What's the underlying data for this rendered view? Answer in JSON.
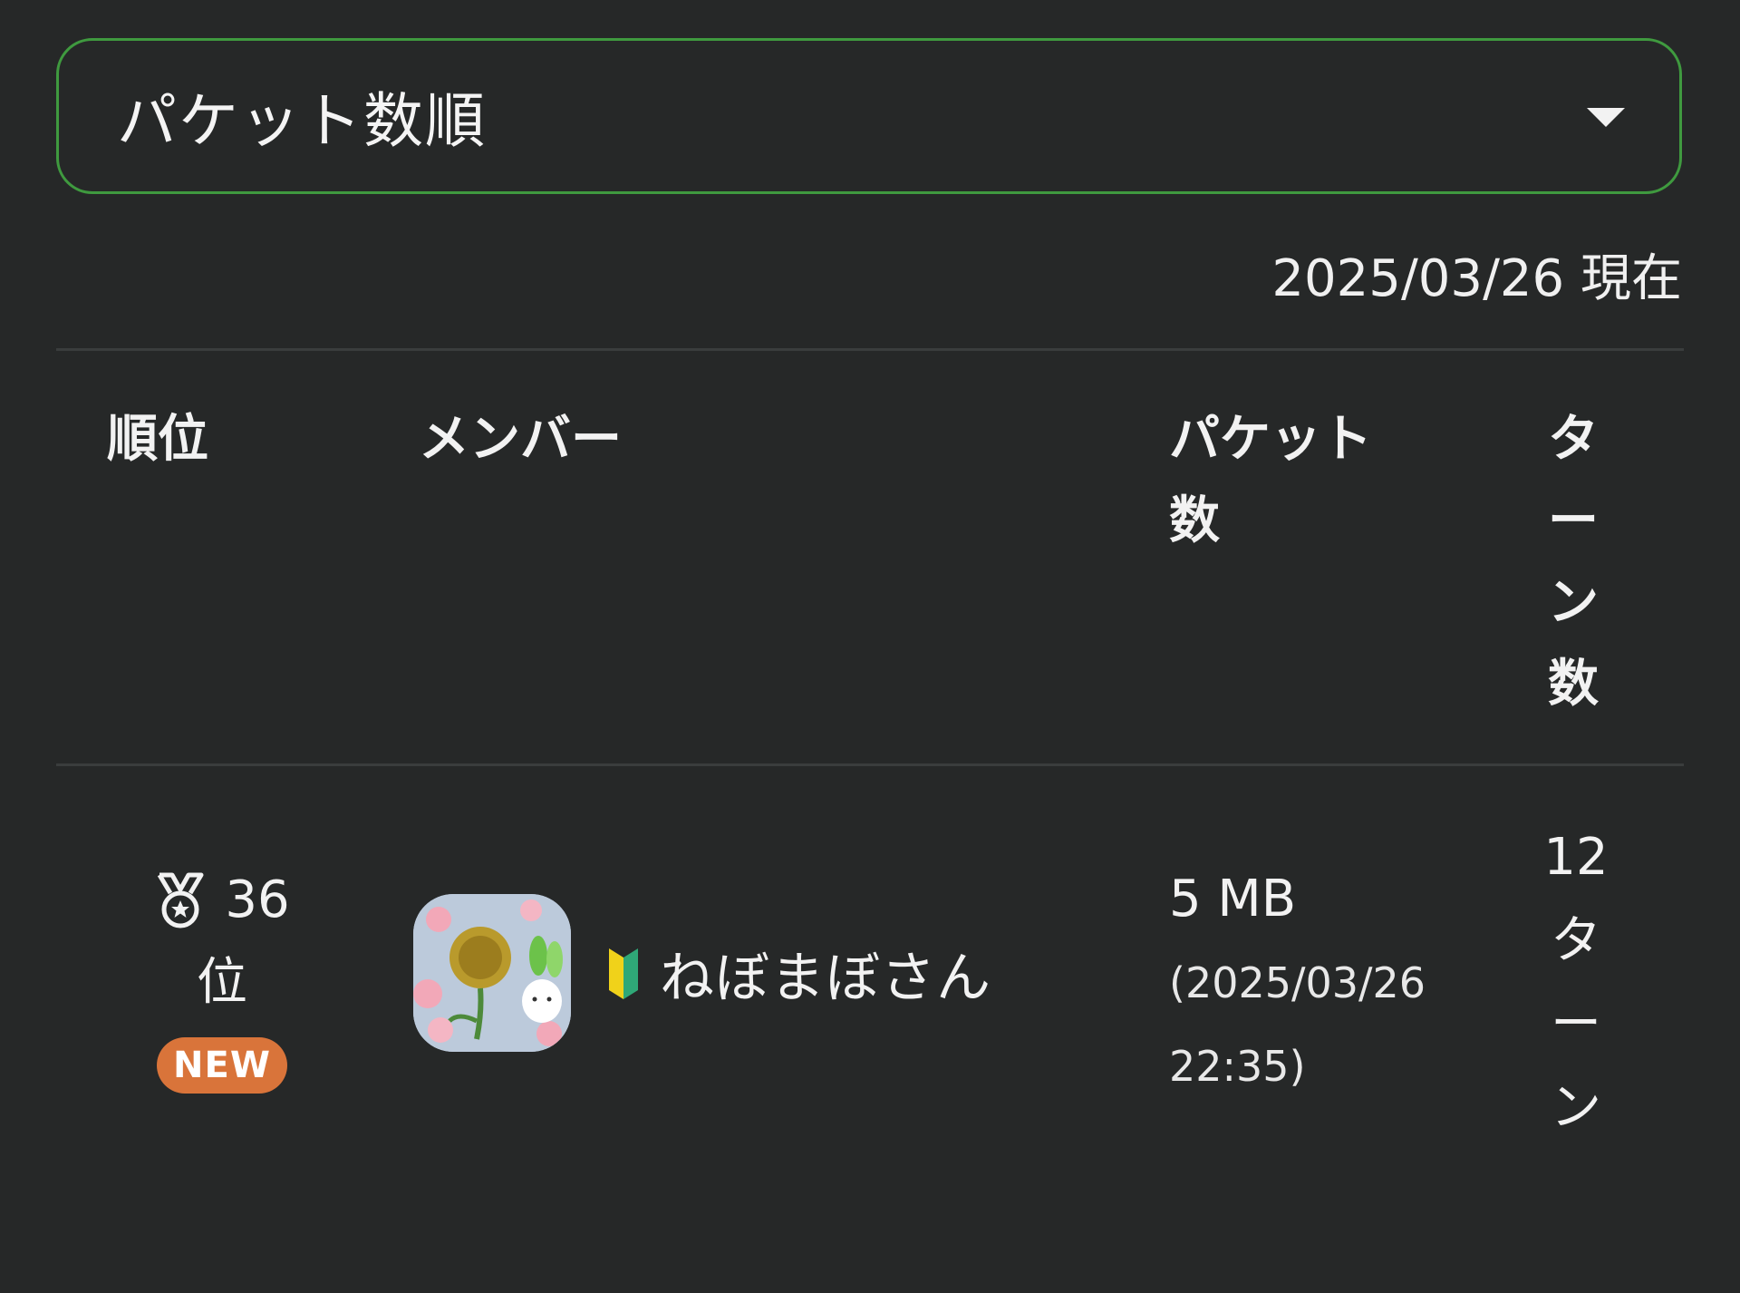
{
  "sort": {
    "selected": "パケット数順"
  },
  "as_of": "2025/03/26 現在",
  "table": {
    "headers": {
      "rank": "順位",
      "member": "メンバー",
      "packets": "パケット数",
      "turns": "ターン数"
    },
    "row": {
      "rank_number": "36",
      "rank_suffix": "位",
      "badge": "NEW",
      "member_name": "ねぼまぼさん",
      "packets": "5 MB",
      "packets_time": "(2025/03/26 22:35)",
      "turns": "12ターン"
    }
  },
  "icons": {
    "medal": "medal-icon",
    "beginner": "beginner-mark-icon",
    "dropdown": "chevron-down-icon"
  },
  "colors": {
    "background": "#262828",
    "select_border": "#3f9a3f",
    "badge": "#d9743a"
  }
}
